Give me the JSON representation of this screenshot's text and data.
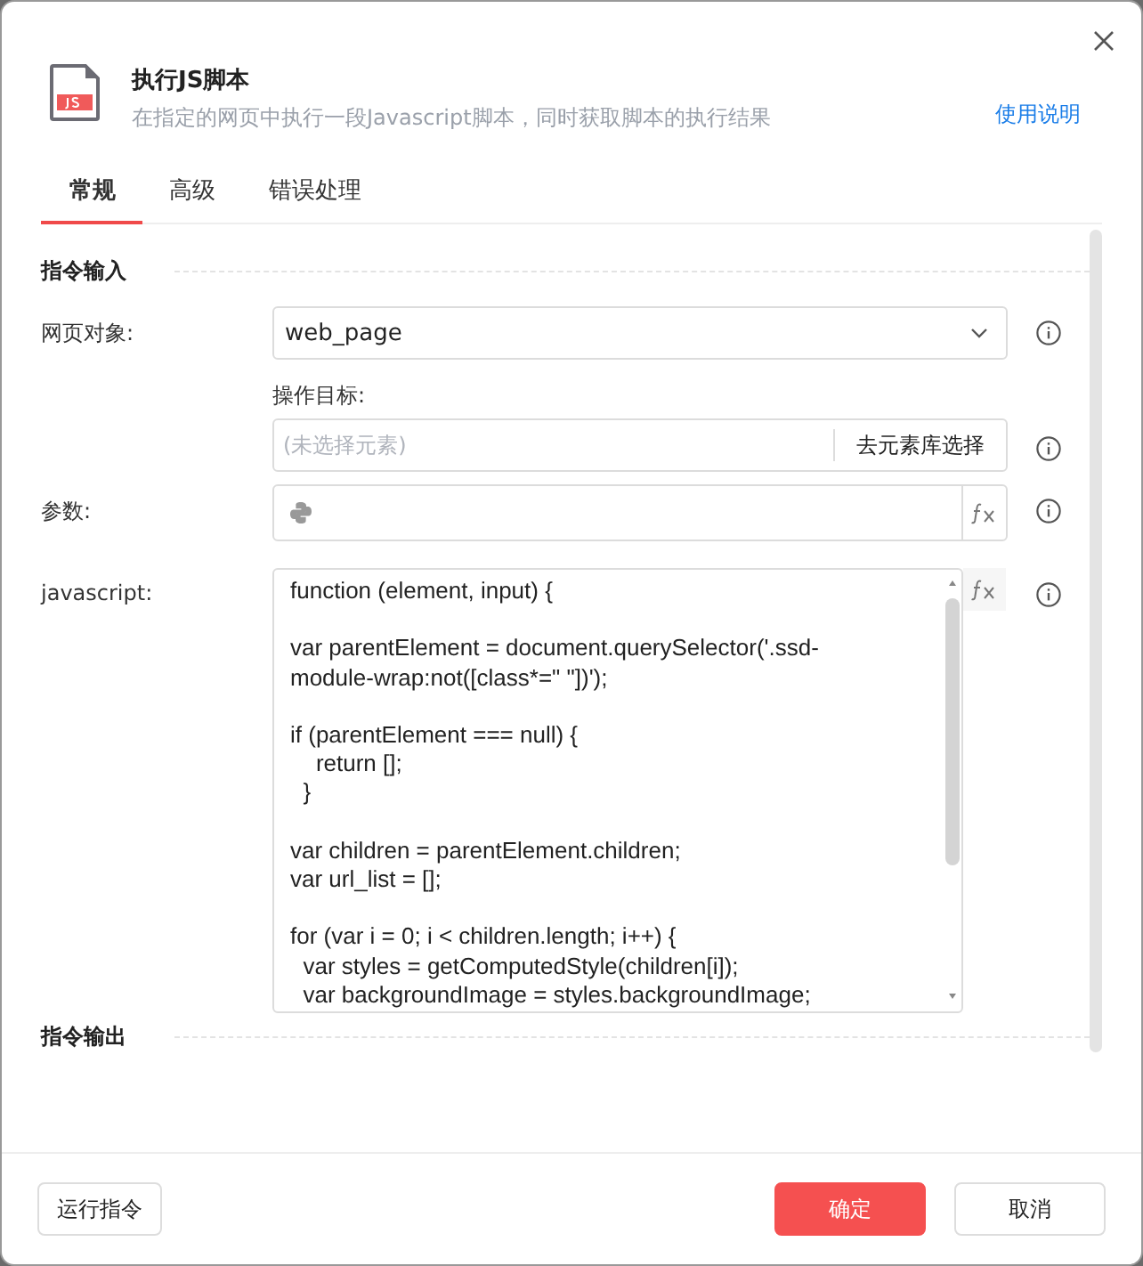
{
  "dialog": {
    "title": "执行JS脚本",
    "subtitle": "在指定的网页中执行一段Javascript脚本，同时获取脚本的执行结果",
    "help_link": "使用说明"
  },
  "tabs": [
    {
      "label": "常规",
      "selected": true
    },
    {
      "label": "高级",
      "selected": false
    },
    {
      "label": "错误处理",
      "selected": false
    }
  ],
  "sections": [
    {
      "title": "指令输入",
      "fields": [
        {
          "kind": "select",
          "label": "网页对象:",
          "value": "web_page"
        },
        {
          "kind": "picker",
          "sublabel": "操作目标:",
          "placeholder": "(未选择元素)",
          "button": "去元素库选择"
        },
        {
          "kind": "python",
          "label": "参数:"
        },
        {
          "kind": "code",
          "label": "javascript:",
          "value": "function (element, input) {\n\nvar parentElement = document.querySelector('.ssd-\nmodule-wrap:not([class*=\" \"])');\n\nif (parentElement === null) {\n    return [];\n  }\n\nvar children = parentElement.children;\nvar url_list = [];\n\nfor (var i = 0; i < children.length; i++) {\n  var styles = getComputedStyle(children[i]);\n  var backgroundImage = styles.backgroundImage;"
        }
      ]
    },
    {
      "title": "指令输出"
    }
  ],
  "footer": {
    "run_button": "运行指令",
    "ok_button": "确定",
    "cancel_button": "取消"
  }
}
